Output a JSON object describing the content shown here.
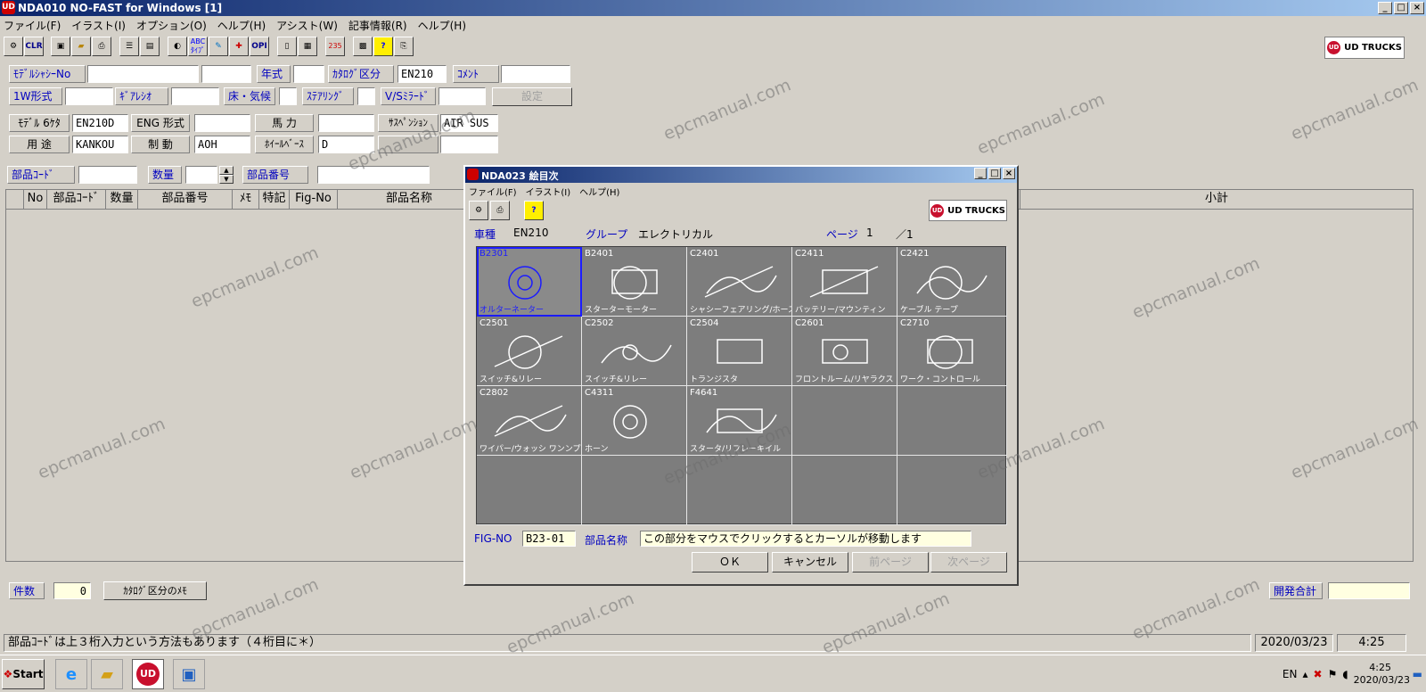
{
  "app": {
    "title": "NDA010 NO-FAST for Windows [1]",
    "icon_text": "UD",
    "menu": [
      "ファイル(F)",
      "イラスト(I)",
      "オプション(O)",
      "ヘルプ(H)",
      "アシスト(W)",
      "記事情報(R)",
      "ヘルプ(H)"
    ],
    "toolbar": {
      "icons": [
        "tools-icon",
        "clr-icon",
        "save-icon",
        "open-folder-icon",
        "print-icon",
        "list-icon",
        "document-icon",
        "globe-icon",
        "abc-type-icon",
        "image-edit-icon",
        "medical-icon",
        "opi-icon",
        "book-icon",
        "calendar-icon",
        "number-icon",
        "grid-icon",
        "help-icon",
        "print-setup-icon"
      ],
      "clr_text": "CLR",
      "opi_text": "OPI",
      "num_text": "235"
    },
    "brand": "UD TRUCKS",
    "brand_mark": "UD"
  },
  "form": {
    "model_chassis_label": "ﾓﾃﾞﾙｼｬｼｰNo",
    "model_chassis_value": "",
    "model_chassis_value2": "",
    "year_label": "年式",
    "year_value": "",
    "catalog_class_label": "ｶﾀﾛｸﾞ区分",
    "catalog_class_value": "EN210",
    "comment_label": "ｺﾒﾝﾄ",
    "comment_value": "",
    "type_1w_label": "1W形式",
    "type_1w_value": "",
    "gear_ratio_label": "ｷﾞｱﾚｼｵ",
    "gear_ratio_value": "",
    "floor_climate_label": "床・気候",
    "floor_climate_value": "",
    "steering_label": "ｽﾃｱﾘﾝｸﾞ",
    "steering_value": "",
    "vs_mirror_label": "V/Sﾐﾗｰﾄﾞ",
    "vs_mirror_value": "",
    "settings_button": "設定",
    "model6_label": "ﾓﾃﾞﾙ 6ｹﾀ",
    "model6_value": "EN210D",
    "eng_label": "ENG 形式",
    "eng_value": "",
    "horsepower_label": "馬 力",
    "horsepower_value": "",
    "suspension_label": "ｻｽﾍﾟﾝｼｮﾝ",
    "suspension_value": "AIR SUS",
    "usage_label": "用 途",
    "usage_value": "KANKOU",
    "brake_label": "制 動",
    "brake_value": "AOH",
    "wheelbase_label": "ﾎｲｰﾙﾍﾞｰｽ",
    "wheelbase_value": "D",
    "extra_value": "",
    "part_code_label": "部品ｺｰﾄﾞ",
    "part_code_value": "",
    "qty_label": "数量",
    "qty_value": "",
    "part_number_label": "部品番号",
    "part_number_value": ""
  },
  "grid": {
    "columns": [
      "No",
      "部品ｺｰﾄﾞ",
      "数量",
      "部品番号",
      "ﾒﾓ",
      "特記",
      "Fig-No",
      "部品名称"
    ],
    "subtotal_label": "小計"
  },
  "bottom": {
    "count_label": "件数",
    "count_value": "0",
    "catalog_memo_button": "ｶﾀﾛｸﾞ区分のﾒﾓ",
    "total_label": "開発合計",
    "total_value": ""
  },
  "status": {
    "message": "部品ｺｰﾄﾞは上３桁入力という方法もあります（４桁目に＊）",
    "date": "2020/03/23",
    "time": "4:25"
  },
  "taskbar": {
    "start": "Start",
    "apps": [
      "ie-icon",
      "explorer-icon",
      "ud-app-icon",
      "remote-icon"
    ],
    "ud_text": "UD",
    "lang": "EN",
    "clock_time": "4:25",
    "clock_date": "2020/03/23"
  },
  "dialog": {
    "title": "NDA023 絵目次",
    "menu": [
      "ファイル(F)",
      "イラスト(I)",
      "ヘルプ(H)"
    ],
    "vehicle_label": "車種",
    "vehicle_value": "EN210",
    "group_label": "グループ",
    "group_value": "エレクトリカル",
    "page_label": "ページ",
    "page_current": "1",
    "page_total": "／1",
    "figures": [
      {
        "code": "B2301",
        "caption": "オルターネーター",
        "icon": "alternator"
      },
      {
        "code": "B2401",
        "caption": "スターターモーター",
        "icon": "starter"
      },
      {
        "code": "C2401",
        "caption": "シャシーフェアリング/ホース",
        "icon": "harness"
      },
      {
        "code": "C2411",
        "caption": "バッテリー/マウンティン",
        "icon": "battery"
      },
      {
        "code": "C2421",
        "caption": "ケーブル テープ",
        "icon": "cable"
      },
      {
        "code": "C2501",
        "caption": "スイッチ&リレー",
        "icon": "switch"
      },
      {
        "code": "C2502",
        "caption": "スイッチ&リレー",
        "icon": "switch2"
      },
      {
        "code": "C2504",
        "caption": "トランジスタ",
        "icon": "box"
      },
      {
        "code": "C2601",
        "caption": "フロントルーム/リヤラクス",
        "icon": "lamps"
      },
      {
        "code": "C2710",
        "caption": "ワーク・コントロール",
        "icon": "control"
      },
      {
        "code": "C2802",
        "caption": "ワイパー/ウォッシ ワンンプDランシャー",
        "icon": "wiper"
      },
      {
        "code": "C4311",
        "caption": "ホーン",
        "icon": "horn"
      },
      {
        "code": "F4641",
        "caption": "スタータ/リフレーキイル",
        "icon": "bracket"
      }
    ],
    "fig_no_label": "FIG-NO",
    "fig_no_value": "B23-01",
    "part_name_label": "部品名称",
    "part_name_value": "この部分をマウスでクリックするとカーソルが移動します",
    "ok_button": "ＯＫ",
    "cancel_button": "キャンセル",
    "prev_button": "前ページ",
    "next_button": "次ページ"
  },
  "watermark": "epcmanual.com"
}
